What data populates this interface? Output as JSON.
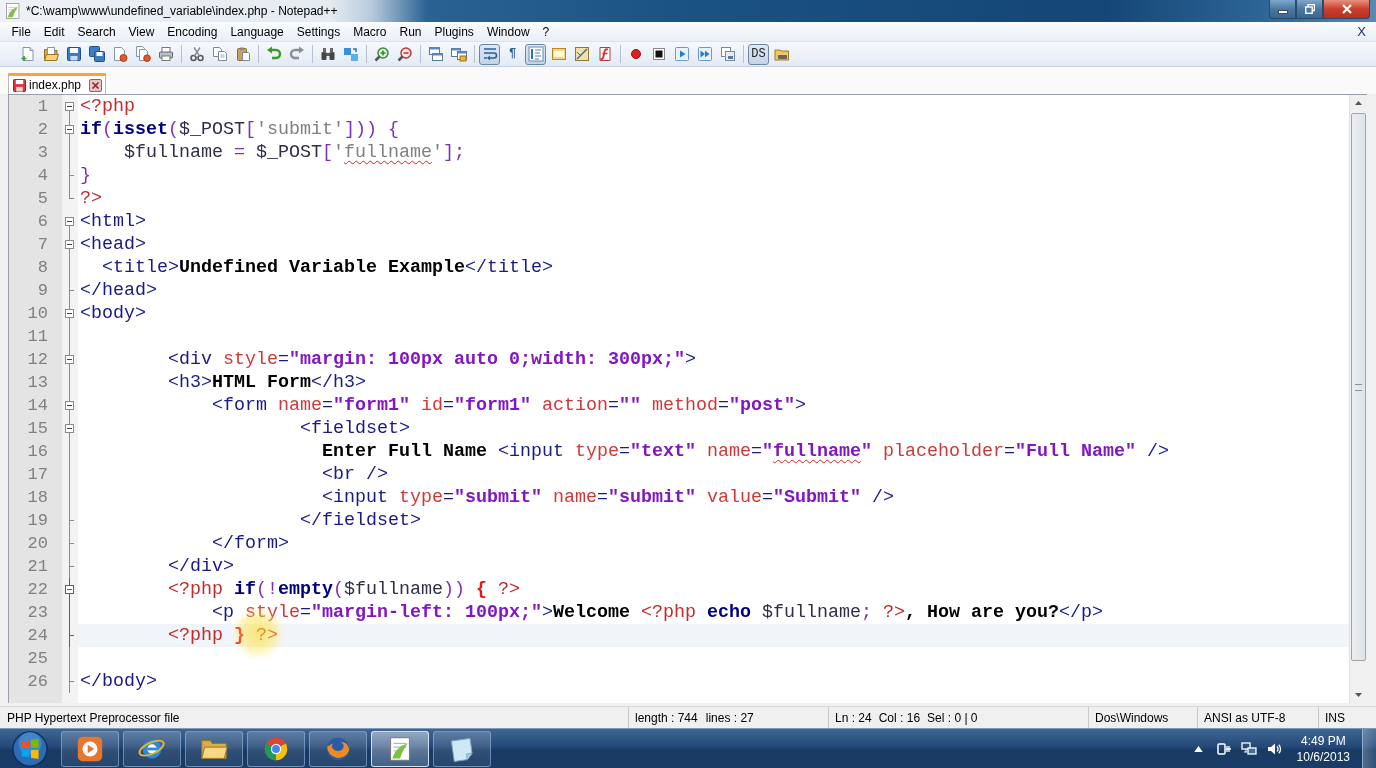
{
  "window": {
    "title": "*C:\\wamp\\www\\undefined_variable\\index.php - Notepad++"
  },
  "menu": {
    "items": [
      "File",
      "Edit",
      "Search",
      "View",
      "Encoding",
      "Language",
      "Settings",
      "Macro",
      "Run",
      "Plugins",
      "Window",
      "?"
    ],
    "close_label": "X"
  },
  "toolbar": [
    {
      "kind": "button",
      "pressed": false
    },
    {
      "kind": "button",
      "pressed": false
    },
    {
      "kind": "button",
      "pressed": false
    },
    {
      "kind": "button",
      "pressed": false
    },
    {
      "kind": "button",
      "pressed": false
    },
    {
      "kind": "button",
      "pressed": false
    },
    {
      "kind": "button",
      "pressed": false
    },
    {
      "kind": "separator"
    },
    {
      "kind": "button",
      "pressed": false
    },
    {
      "kind": "button",
      "pressed": false
    },
    {
      "kind": "button",
      "pressed": false
    },
    {
      "kind": "separator"
    },
    {
      "kind": "button",
      "pressed": false
    },
    {
      "kind": "button",
      "pressed": false
    },
    {
      "kind": "separator"
    },
    {
      "kind": "button",
      "pressed": false
    },
    {
      "kind": "button",
      "pressed": false
    },
    {
      "kind": "separator"
    },
    {
      "kind": "button",
      "pressed": false
    },
    {
      "kind": "button",
      "pressed": false
    },
    {
      "kind": "separator"
    },
    {
      "kind": "button",
      "pressed": false
    },
    {
      "kind": "button",
      "pressed": false
    },
    {
      "kind": "separator"
    },
    {
      "kind": "button",
      "pressed": true
    },
    {
      "kind": "button",
      "label": "¶",
      "pressed": false
    },
    {
      "kind": "button",
      "pressed": true
    },
    {
      "kind": "button",
      "pressed": false
    },
    {
      "kind": "button",
      "pressed": false
    },
    {
      "kind": "button",
      "pressed": false
    },
    {
      "kind": "separator"
    },
    {
      "kind": "button",
      "pressed": false
    },
    {
      "kind": "button",
      "pressed": false
    },
    {
      "kind": "button",
      "pressed": false
    },
    {
      "kind": "button",
      "pressed": false
    },
    {
      "kind": "button",
      "pressed": false
    },
    {
      "kind": "separator"
    },
    {
      "kind": "button",
      "label": "DS",
      "pressed": true
    },
    {
      "kind": "button",
      "pressed": false
    }
  ],
  "tabs": [
    {
      "label": "index.php",
      "selected": true,
      "modified": true
    }
  ],
  "editor": {
    "lines": [
      {
        "number": "1",
        "fold_start": true,
        "fold_end": false,
        "fold_active": false,
        "current": false,
        "tokens": [
          {
            "text": "<?php",
            "kind": "phptag"
          }
        ]
      },
      {
        "number": "2",
        "fold_start": true,
        "fold_end": false,
        "fold_active": false,
        "current": false,
        "tokens": [
          {
            "text": "if",
            "kind": "keyword"
          },
          {
            "text": "(",
            "kind": "operator"
          },
          {
            "text": "isset",
            "kind": "keyword"
          },
          {
            "text": "(",
            "kind": "operator"
          },
          {
            "text": "$_POST",
            "kind": "variable"
          },
          {
            "text": "[",
            "kind": "operator"
          },
          {
            "text": "'submit'",
            "kind": "string"
          },
          {
            "text": "])) {",
            "kind": "operator"
          }
        ]
      },
      {
        "number": "3",
        "fold_start": false,
        "fold_end": false,
        "fold_active": false,
        "current": false,
        "tokens": [
          {
            "text": "    $fullname",
            "kind": "variable"
          },
          {
            "text": " = ",
            "kind": "operator"
          },
          {
            "text": "$_POST",
            "kind": "variable"
          },
          {
            "text": "[",
            "kind": "operator"
          },
          {
            "text": "'",
            "kind": "string"
          },
          {
            "text": "fullname",
            "kind": "string",
            "misspelled": true
          },
          {
            "text": "'",
            "kind": "string"
          },
          {
            "text": "];",
            "kind": "operator"
          }
        ]
      },
      {
        "number": "4",
        "fold_start": false,
        "fold_end": true,
        "fold_active": false,
        "current": false,
        "tokens": [
          {
            "text": "}",
            "kind": "operator"
          }
        ]
      },
      {
        "number": "5",
        "fold_start": false,
        "fold_end": true,
        "fold_active": false,
        "current": false,
        "tokens": [
          {
            "text": "?>",
            "kind": "phptag"
          }
        ]
      },
      {
        "number": "6",
        "fold_start": true,
        "fold_end": false,
        "fold_active": false,
        "current": false,
        "tokens": [
          {
            "text": "<html>",
            "kind": "tag"
          }
        ]
      },
      {
        "number": "7",
        "fold_start": true,
        "fold_end": false,
        "fold_active": false,
        "current": false,
        "tokens": [
          {
            "text": "<head>",
            "kind": "tag"
          }
        ]
      },
      {
        "number": "8",
        "fold_start": false,
        "fold_end": false,
        "fold_active": false,
        "current": false,
        "tokens": [
          {
            "text": "  <title>",
            "kind": "tag"
          },
          {
            "text": "Undefined Variable Example",
            "kind": "text"
          },
          {
            "text": "</title>",
            "kind": "tag"
          }
        ]
      },
      {
        "number": "9",
        "fold_start": false,
        "fold_end": true,
        "fold_active": false,
        "current": false,
        "tokens": [
          {
            "text": "</head>",
            "kind": "tag"
          }
        ]
      },
      {
        "number": "10",
        "fold_start": true,
        "fold_end": false,
        "fold_active": false,
        "current": false,
        "tokens": [
          {
            "text": "<body>",
            "kind": "tag"
          }
        ]
      },
      {
        "number": "11",
        "fold_start": false,
        "fold_end": false,
        "fold_active": false,
        "current": false
      },
      {
        "number": "12",
        "fold_start": true,
        "fold_end": false,
        "fold_active": false,
        "current": false,
        "tokens": [
          {
            "text": "        <div ",
            "kind": "tag"
          },
          {
            "text": "style",
            "kind": "attribute"
          },
          {
            "text": "=",
            "kind": "tag"
          },
          {
            "text": "\"margin: 100px auto 0;width: 300px;\"",
            "kind": "value"
          },
          {
            "text": ">",
            "kind": "tag"
          }
        ]
      },
      {
        "number": "13",
        "fold_start": false,
        "fold_end": false,
        "fold_active": false,
        "current": false,
        "tokens": [
          {
            "text": "        <h3>",
            "kind": "tag"
          },
          {
            "text": "HTML Form",
            "kind": "text"
          },
          {
            "text": "</h3>",
            "kind": "tag"
          }
        ]
      },
      {
        "number": "14",
        "fold_start": true,
        "fold_end": false,
        "fold_active": false,
        "current": false,
        "tokens": [
          {
            "text": "            <form ",
            "kind": "tag"
          },
          {
            "text": "name",
            "kind": "attribute"
          },
          {
            "text": "=",
            "kind": "tag"
          },
          {
            "text": "\"form1\"",
            "kind": "value"
          },
          {
            "text": " id",
            "kind": "attribute"
          },
          {
            "text": "=",
            "kind": "tag"
          },
          {
            "text": "\"form1\"",
            "kind": "value"
          },
          {
            "text": " action",
            "kind": "attribute"
          },
          {
            "text": "=",
            "kind": "tag"
          },
          {
            "text": "\"\"",
            "kind": "value"
          },
          {
            "text": " method",
            "kind": "attribute"
          },
          {
            "text": "=",
            "kind": "tag"
          },
          {
            "text": "\"post\"",
            "kind": "value"
          },
          {
            "text": ">",
            "kind": "tag"
          }
        ]
      },
      {
        "number": "15",
        "fold_start": true,
        "fold_end": false,
        "fold_active": false,
        "current": false,
        "tokens": [
          {
            "text": "                    <fieldset>",
            "kind": "tag"
          }
        ]
      },
      {
        "number": "16",
        "fold_start": false,
        "fold_end": false,
        "fold_active": false,
        "current": false,
        "tokens": [
          {
            "text": "                      Enter Full Name ",
            "kind": "text"
          },
          {
            "text": "<input ",
            "kind": "tag"
          },
          {
            "text": "type",
            "kind": "attribute"
          },
          {
            "text": "=",
            "kind": "tag"
          },
          {
            "text": "\"text\"",
            "kind": "value"
          },
          {
            "text": " name",
            "kind": "attribute"
          },
          {
            "text": "=",
            "kind": "tag"
          },
          {
            "text": "\"",
            "kind": "value"
          },
          {
            "text": "fullname",
            "kind": "value",
            "misspelled": true
          },
          {
            "text": "\"",
            "kind": "value"
          },
          {
            "text": " placeholder",
            "kind": "attribute"
          },
          {
            "text": "=",
            "kind": "tag"
          },
          {
            "text": "\"Full Name\"",
            "kind": "value"
          },
          {
            "text": " />",
            "kind": "tag"
          }
        ]
      },
      {
        "number": "17",
        "fold_start": false,
        "fold_end": false,
        "fold_active": false,
        "current": false,
        "tokens": [
          {
            "text": "                      <br />",
            "kind": "tag"
          }
        ]
      },
      {
        "number": "18",
        "fold_start": false,
        "fold_end": false,
        "fold_active": false,
        "current": false,
        "tokens": [
          {
            "text": "                      <input ",
            "kind": "tag"
          },
          {
            "text": "type",
            "kind": "attribute"
          },
          {
            "text": "=",
            "kind": "tag"
          },
          {
            "text": "\"submit\"",
            "kind": "value"
          },
          {
            "text": " name",
            "kind": "attribute"
          },
          {
            "text": "=",
            "kind": "tag"
          },
          {
            "text": "\"submit\"",
            "kind": "value"
          },
          {
            "text": " value",
            "kind": "attribute"
          },
          {
            "text": "=",
            "kind": "tag"
          },
          {
            "text": "\"Submit\"",
            "kind": "value"
          },
          {
            "text": " />",
            "kind": "tag"
          }
        ]
      },
      {
        "number": "19",
        "fold_start": false,
        "fold_end": true,
        "fold_active": false,
        "current": false,
        "tokens": [
          {
            "text": "                    </fieldset>",
            "kind": "tag"
          }
        ]
      },
      {
        "number": "20",
        "fold_start": false,
        "fold_end": true,
        "fold_active": false,
        "current": false,
        "tokens": [
          {
            "text": "            </form>",
            "kind": "tag"
          }
        ]
      },
      {
        "number": "21",
        "fold_start": false,
        "fold_end": true,
        "fold_active": false,
        "current": false,
        "tokens": [
          {
            "text": "        </div>",
            "kind": "tag"
          }
        ]
      },
      {
        "number": "22",
        "fold_start": true,
        "fold_end": false,
        "fold_active": true,
        "current": false,
        "tokens": [
          {
            "text": "        <?php",
            "kind": "phptag"
          },
          {
            "text": " if",
            "kind": "keyword"
          },
          {
            "text": "(!",
            "kind": "operator"
          },
          {
            "text": "empty",
            "kind": "keyword"
          },
          {
            "text": "(",
            "kind": "operator"
          },
          {
            "text": "$fullname",
            "kind": "variable"
          },
          {
            "text": ")) ",
            "kind": "operator"
          },
          {
            "text": "{",
            "kind": "brace",
            "matched": true
          },
          {
            "text": " ?>",
            "kind": "phptag"
          }
        ]
      },
      {
        "number": "23",
        "fold_start": false,
        "fold_end": false,
        "fold_active": true,
        "current": false,
        "tokens": [
          {
            "text": "            <p ",
            "kind": "tag"
          },
          {
            "text": "style",
            "kind": "attribute"
          },
          {
            "text": "=",
            "kind": "tag"
          },
          {
            "text": "\"margin-left: 100px;\"",
            "kind": "value"
          },
          {
            "text": ">",
            "kind": "tag"
          },
          {
            "text": "Welcome ",
            "kind": "text"
          },
          {
            "text": "<?php",
            "kind": "phptag"
          },
          {
            "text": " echo",
            "kind": "keyword"
          },
          {
            "text": " $fullname",
            "kind": "variable"
          },
          {
            "text": ";",
            "kind": "operator"
          },
          {
            "text": " ?>",
            "kind": "phptag"
          },
          {
            "text": ", How are you?",
            "kind": "text"
          },
          {
            "text": "</p>",
            "kind": "tag"
          }
        ]
      },
      {
        "number": "24",
        "fold_start": false,
        "fold_end": true,
        "fold_active": true,
        "current": true,
        "tokens": [
          {
            "text": "        <?php ",
            "kind": "phptag"
          },
          {
            "text": "}",
            "kind": "brace",
            "matched": true
          },
          {
            "text": " ?>",
            "kind": "phptag"
          }
        ]
      },
      {
        "number": "25",
        "fold_start": false,
        "fold_end": false,
        "fold_active": false,
        "current": false
      },
      {
        "number": "26",
        "fold_start": false,
        "fold_end": true,
        "fold_active": false,
        "current": false,
        "tokens": [
          {
            "text": "</body>",
            "kind": "tag"
          }
        ]
      }
    ]
  },
  "status_bar": {
    "file_type": "PHP Hypertext Preprocessor file",
    "length": "length : 744",
    "lines": "lines : 27",
    "line": "Ln : 24",
    "column": "Col : 16",
    "selection": "Sel : 0 | 0",
    "eol": "Dos\\Windows",
    "encoding": "ANSI as UTF-8",
    "mode": "INS"
  },
  "taskbar": {
    "apps": [
      {
        "selected": false
      },
      {
        "selected": false
      },
      {
        "selected": false
      },
      {
        "selected": false
      },
      {
        "selected": false
      },
      {
        "selected": true
      },
      {
        "selected": false
      }
    ],
    "clock": {
      "time": "4:49 PM",
      "date": "10/6/2013"
    }
  }
}
